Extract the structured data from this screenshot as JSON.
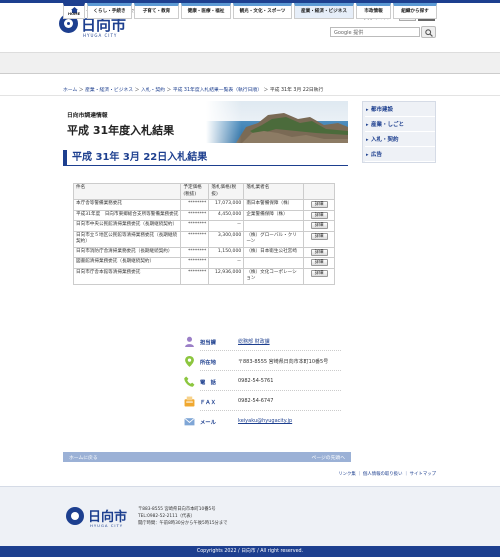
{
  "header": {
    "tagline": "海・山・人のつながり 笑顔で暮らせる日向をめざす",
    "logo_text": "日向市",
    "logo_sub": "HYUGA CITY",
    "fontsize_label": "文字サイズ",
    "fontsize_large": "拡大",
    "fontsize_standard": "標準",
    "search_placeholder": "Google 提供"
  },
  "nav": {
    "home": "HOME",
    "items": [
      {
        "label": "くらし・手続き"
      },
      {
        "label": "子育て・教育"
      },
      {
        "label": "健康・医療・福祉"
      },
      {
        "label": "観光・文化・スポーツ"
      },
      {
        "label": "産業・経済・ビジネス"
      },
      {
        "label": "市政情報"
      },
      {
        "label": "組織から探す"
      }
    ]
  },
  "breadcrumb": {
    "items": [
      "ホーム",
      "産業・経済・ビジネス",
      "入札・契約",
      "平成 31年度入札結果一覧表（執行日順）"
    ],
    "current": "平成 31年 3月 22日執行"
  },
  "banner": {
    "category": "日向市調達情報",
    "title": "平成 31年度入札結果"
  },
  "side_nav": {
    "items": [
      {
        "label": "都市建設"
      },
      {
        "label": "産業・しごと"
      },
      {
        "label": "入札・契約"
      },
      {
        "label": "広告"
      }
    ]
  },
  "page_title": "平成 31年 3月 22日入札結果",
  "table": {
    "headers": [
      "件名",
      "予定価格(税抜)",
      "落札価格(税抜)",
      "落札業者名",
      ""
    ],
    "detail_label": "詳細",
    "rows": [
      {
        "name": "本庁舎等警備業務委託",
        "planned": "********",
        "price": "17,073,000",
        "vendor": "南日本警備保障（株）"
      },
      {
        "name": "平成31年度　日向市東郷総合支所等警備業務委託",
        "planned": "********",
        "price": "4,450,000",
        "vendor": "企業警備保障（株）"
      },
      {
        "name": "日向市中央公民館清掃業務委託（長期継続契約）",
        "planned": "********",
        "price": "－",
        "vendor": ""
      },
      {
        "name": "日向市立５地区公民館等清掃業務委託（長期継続契約）",
        "planned": "********",
        "price": "3,300,000",
        "vendor": "（株）グローバル・クリーン"
      },
      {
        "name": "日向市消防庁舎清掃業務委託（長期継続契約）",
        "planned": "********",
        "price": "1,150,000",
        "vendor": "（株）日本衛生公社宮崎"
      },
      {
        "name": "図書館清掃業務委託（長期継続契約）",
        "planned": "********",
        "price": "－",
        "vendor": ""
      },
      {
        "name": "日向市庁舎本館等清掃業務委託",
        "planned": "********",
        "price": "12,936,000",
        "vendor": "（株）文化コーポレーション"
      }
    ]
  },
  "contact": {
    "dept_label": "担当課",
    "dept_value": "総務部 財政課",
    "address_label": "所在地",
    "address_value": "〒883-8555 宮崎県日向市本町10番5号",
    "phone_label": "電　話",
    "phone_value": "0982-54-5761",
    "fax_label": "ＦＡＸ",
    "fax_value": "0982-54-6747",
    "mail_label": "メール",
    "mail_value": "keiyaku@hyugacity.jp"
  },
  "pagebar": {
    "home": "ホームに戻る",
    "top": "ページの先頭へ"
  },
  "sublinks": "リンク集 ｜ 個人情報の取り扱い ｜ サイトマップ",
  "footer": {
    "logo_text": "日向市",
    "logo_sub": "HYUGA CITY",
    "address": "〒883-8555 宮崎県日向市本町10番5号",
    "tel": "TEL:0982-52-2111（代表）",
    "hours": "開庁時間：午前8時30分から午後5時15分まで"
  },
  "copyright": "Copyrights 2022 / 日向市 / All right reserved.",
  "colors": {
    "primary": "#1d3f8f",
    "accent": "#5c9ad4",
    "pagebar": "#9bb1d6"
  }
}
